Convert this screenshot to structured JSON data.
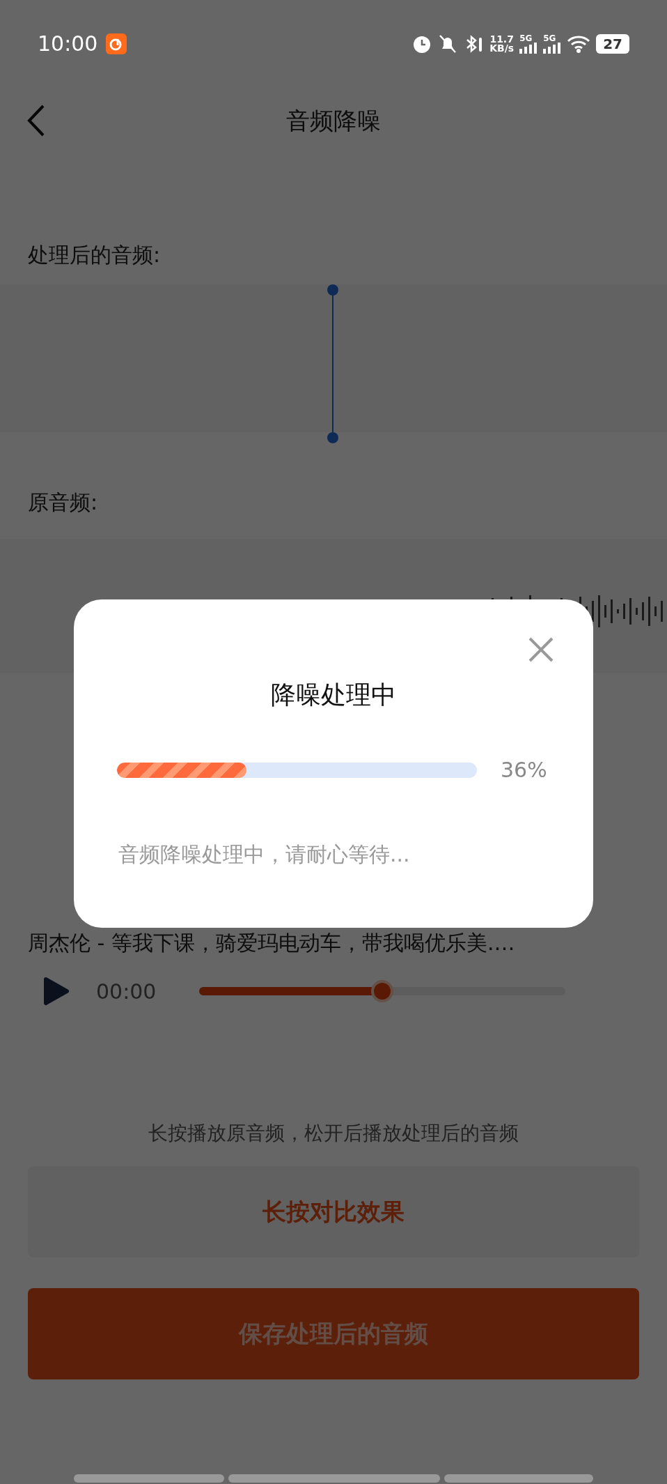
{
  "status_bar": {
    "time": "10:00",
    "speed_value": "11.7",
    "speed_unit": "KB/s",
    "signals": [
      "5G",
      "5G"
    ],
    "battery": "27"
  },
  "header": {
    "title": "音频降噪"
  },
  "processed": {
    "label": "处理后的音频:"
  },
  "original": {
    "label": "原音频:"
  },
  "track": {
    "title": "周杰伦 - 等我下课，骑爱玛电动车，带我喝优乐美.…",
    "time": "00:00",
    "level": 0.5
  },
  "hint": "长按播放原音频，松开后播放处理后的音频",
  "buttons": [
    {
      "kind": "secondary",
      "label": "长按对比效果"
    },
    {
      "kind": "primary",
      "label": "保存处理后的音频"
    }
  ],
  "dialog": {
    "title": "降噪处理中",
    "level": 0.36,
    "percent": "36%",
    "message": "音频降噪处理中，请耐心等待..."
  }
}
